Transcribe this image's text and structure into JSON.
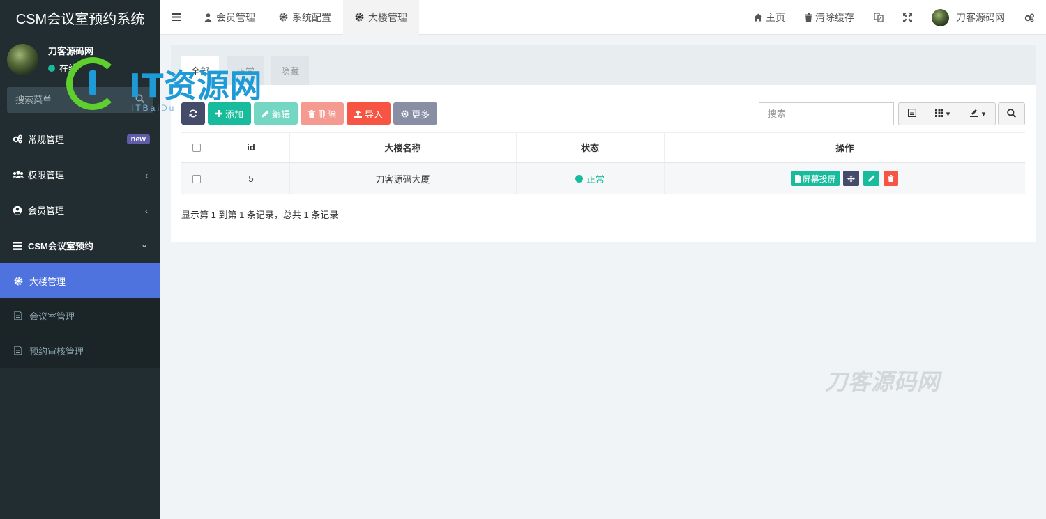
{
  "sidebar": {
    "brand": "CSM会议室预约系统",
    "user": {
      "name": "刀客源码网",
      "status": "在线"
    },
    "search_placeholder": "搜索菜单",
    "menu": [
      {
        "label": "常规管理",
        "icon": "cogs-icon",
        "badge": "new"
      },
      {
        "label": "权限管理",
        "icon": "group-icon"
      },
      {
        "label": "会员管理",
        "icon": "user-circle-icon"
      },
      {
        "label": "CSM会议室预约",
        "icon": "list-icon"
      }
    ],
    "submenu": [
      {
        "label": "大楼管理",
        "icon": "gear-icon",
        "active": true
      },
      {
        "label": "会议室管理",
        "icon": "file-icon"
      },
      {
        "label": "预约审核管理",
        "icon": "file-icon"
      }
    ]
  },
  "header": {
    "tabs": [
      {
        "label": "会员管理",
        "icon": "user-icon"
      },
      {
        "label": "系统配置",
        "icon": "gear-icon"
      },
      {
        "label": "大楼管理",
        "icon": "gear-icon",
        "active": true
      }
    ],
    "right": {
      "home": "主页",
      "clear_cache": "清除缓存",
      "user_name": "刀客源码网"
    }
  },
  "content": {
    "subtabs": [
      "全部",
      "正常",
      "隐藏"
    ],
    "toolbar": {
      "refresh": "",
      "add": "添加",
      "edit": "编辑",
      "delete": "删除",
      "import": "导入",
      "more": "更多"
    },
    "search_placeholder": "搜索",
    "table": {
      "columns": [
        "id",
        "大楼名称",
        "状态",
        "操作"
      ],
      "rows": [
        {
          "id": "5",
          "name": "刀客源码大厦",
          "status": "正常",
          "action_screen": "屏幕投屏"
        }
      ]
    },
    "pagination_info": "显示第 1 到第 1 条记录，总共 1 条记录"
  },
  "watermarks": {
    "logo_text": "IT资源网",
    "logo_sub": "ITBaiDu",
    "corner_text": "刀客源码网"
  },
  "colors": {
    "sidebar_bg": "#222d32",
    "active_item": "#4e73df",
    "primary_green": "#18bc9c",
    "danger_red": "#f75444",
    "dark_btn": "#444c69"
  }
}
